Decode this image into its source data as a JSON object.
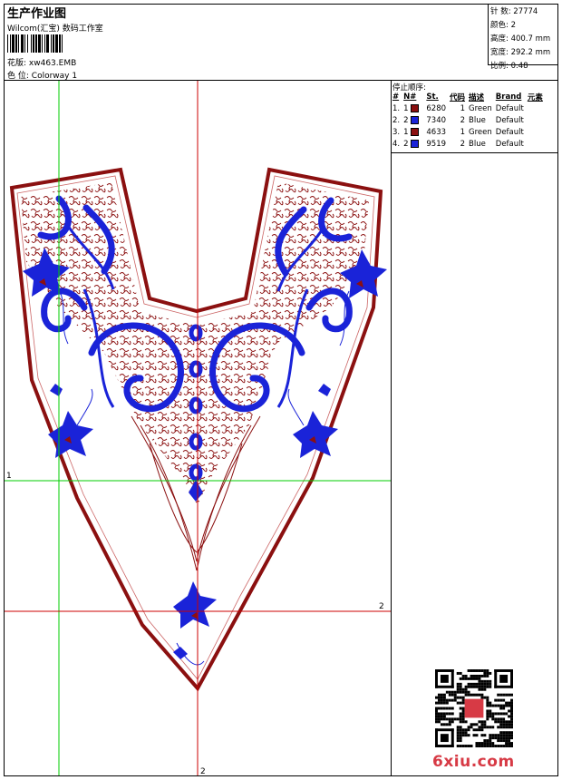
{
  "header": {
    "title": "生产作业图",
    "company": "Wilcom(汇宝) 数码工作室",
    "design_label": "花版:",
    "design_file": "xw463.EMB",
    "colorway_label": "色 位:",
    "colorway": "Colorway 1"
  },
  "stats": [
    {
      "label": "针 数:",
      "value": "27774"
    },
    {
      "label": "颜色:",
      "value": "2"
    },
    {
      "label": "高度:",
      "value": "400.7 mm"
    },
    {
      "label": "宽度:",
      "value": "292.2 mm"
    },
    {
      "label": "比例:",
      "value": "0.48"
    }
  ],
  "stop_sequence": {
    "title": "停止顺序:",
    "columns": [
      "#",
      "N#",
      "St.",
      "代码",
      "描述",
      "Brand",
      "元素"
    ],
    "rows": [
      {
        "num": "1.",
        "n": "1",
        "color": "#8b1010",
        "st": "6280",
        "code": "1",
        "desc": "Green",
        "brand": "Default"
      },
      {
        "num": "2.",
        "n": "2",
        "color": "#1a23d8",
        "st": "7340",
        "code": "2",
        "desc": "Blue",
        "brand": "Default"
      },
      {
        "num": "3.",
        "n": "1",
        "color": "#8b1010",
        "st": "4633",
        "code": "1",
        "desc": "Green",
        "brand": "Default"
      },
      {
        "num": "4.",
        "n": "2",
        "color": "#1a23d8",
        "st": "9519",
        "code": "2",
        "desc": "Blue",
        "brand": "Default"
      }
    ]
  },
  "guides": {
    "label_1": "1",
    "label_2": "2"
  },
  "colors": {
    "thread_red": "#8b1010",
    "thread_blue": "#1a23d8",
    "guide_green": "#00cc00",
    "guide_red": "#cc0000"
  },
  "watermark": "6xiu.com"
}
